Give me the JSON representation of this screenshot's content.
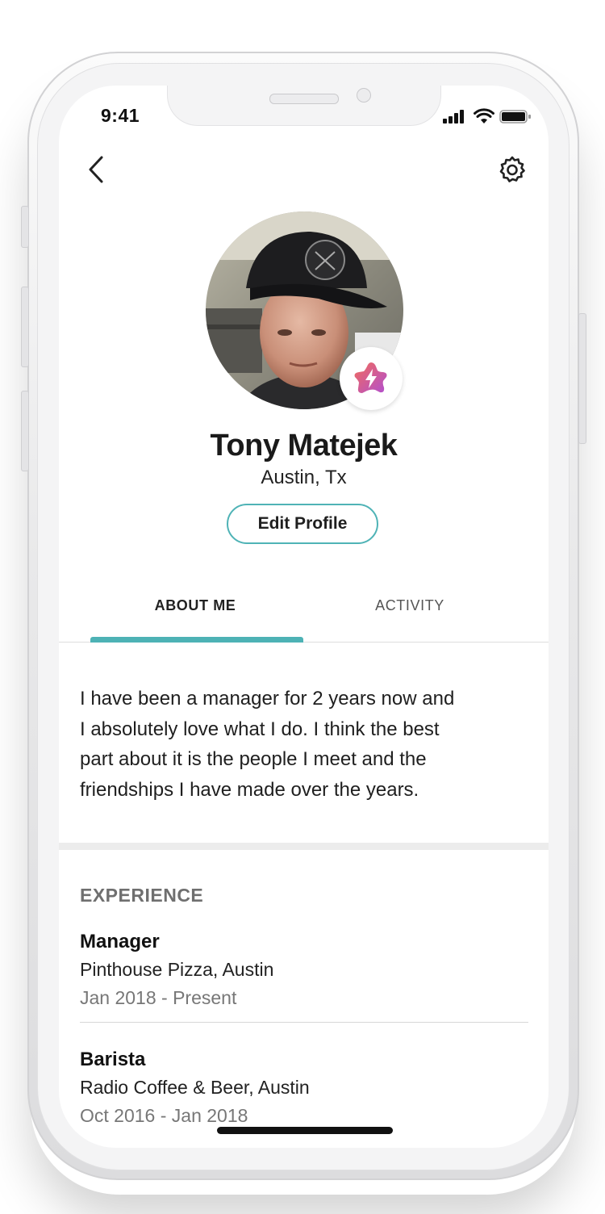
{
  "status_bar": {
    "time": "9:41"
  },
  "nav": {
    "back_icon": "chevron-left-icon",
    "settings_icon": "gear-icon"
  },
  "profile": {
    "name": "Tony Matejek",
    "location": "Austin, Tx",
    "edit_label": "Edit Profile",
    "badge_icon": "lightning-star-icon"
  },
  "tabs": [
    {
      "label": "ABOUT ME",
      "active": true
    },
    {
      "label": "ACTIVITY",
      "active": false
    }
  ],
  "about": {
    "lines": [
      "I have been a manager for 2 years now and",
      "I absolutely love what I do. I think the best",
      "part about it is the people I meet and the",
      "friendships I have made over the years."
    ]
  },
  "experience": {
    "heading": "EXPERIENCE",
    "items": [
      {
        "title": "Manager",
        "company": "Pinthouse Pizza, Austin",
        "dates": "Jan 2018 - Present"
      },
      {
        "title": "Barista",
        "company": "Radio Coffee & Beer, Austin",
        "dates": "Oct 2016 - Jan 2018"
      }
    ]
  },
  "colors": {
    "accent": "#4db2b5"
  }
}
